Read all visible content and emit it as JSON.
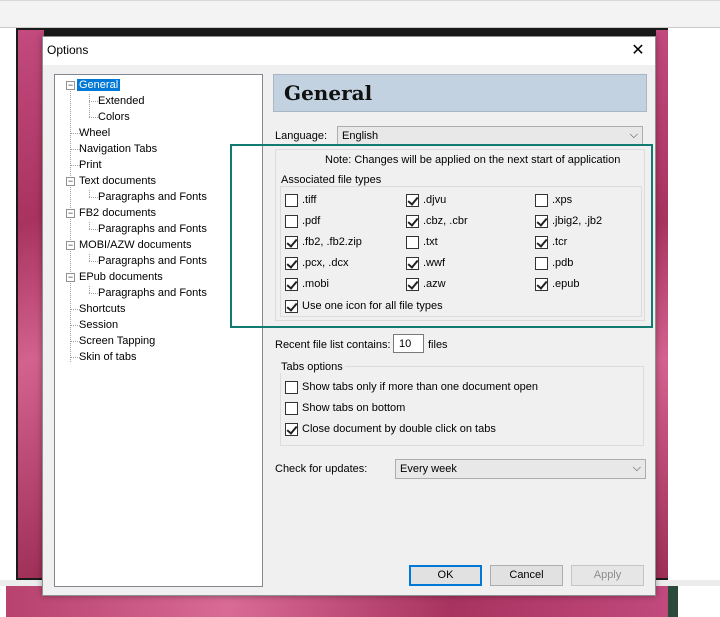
{
  "dialog": {
    "title": "Options"
  },
  "tree": [
    {
      "label": "General",
      "selected": true
    },
    {
      "label": "Extended"
    },
    {
      "label": "Colors"
    },
    {
      "label": "Wheel"
    },
    {
      "label": "Navigation Tabs"
    },
    {
      "label": "Print"
    },
    {
      "label": "Text documents"
    },
    {
      "label": "Paragraphs and Fonts"
    },
    {
      "label": "FB2 documents"
    },
    {
      "label": "Paragraphs and Fonts"
    },
    {
      "label": "MOBI/AZW documents"
    },
    {
      "label": "Paragraphs and Fonts"
    },
    {
      "label": "EPub documents"
    },
    {
      "label": "Paragraphs and Fonts"
    },
    {
      "label": "Shortcuts"
    },
    {
      "label": "Session"
    },
    {
      "label": "Screen Tapping"
    },
    {
      "label": "Skin of tabs"
    }
  ],
  "tree_expanders": [
    "−",
    "−",
    "−",
    "−",
    "−"
  ],
  "page": {
    "header": "General",
    "language_label": "Language:",
    "language_value": "English",
    "note": "Note: Changes will be applied on the next start of application",
    "assoc_title": "Associated file types",
    "filetypes": [
      {
        "label": ".tiff",
        "checked": false
      },
      {
        "label": ".djvu",
        "checked": true
      },
      {
        "label": ".xps",
        "checked": false
      },
      {
        "label": ".pdf",
        "checked": false
      },
      {
        "label": ".cbz, .cbr",
        "checked": true
      },
      {
        "label": ".jbig2, .jb2",
        "checked": true
      },
      {
        "label": ".fb2, .fb2.zip",
        "checked": true
      },
      {
        "label": ".txt",
        "checked": false
      },
      {
        "label": ".tcr",
        "checked": true
      },
      {
        "label": ".pcx, .dcx",
        "checked": true
      },
      {
        "label": ".wwf",
        "checked": true
      },
      {
        "label": ".pdb",
        "checked": false
      },
      {
        "label": ".mobi",
        "checked": true
      },
      {
        "label": ".azw",
        "checked": true
      },
      {
        "label": ".epub",
        "checked": true
      }
    ],
    "one_icon": {
      "label": "Use one icon for all file types",
      "checked": true
    },
    "recent_label": "Recent file list contains:",
    "recent_value": "10",
    "recent_suffix": "files",
    "tabs_title": "Tabs options",
    "tabs_options": [
      {
        "label": "Show tabs only if more than one document open",
        "checked": false
      },
      {
        "label": "Show tabs on bottom",
        "checked": false
      },
      {
        "label": "Close document by double click on tabs",
        "checked": true
      }
    ],
    "updates_label": "Check for updates:",
    "updates_value": "Every week"
  },
  "buttons": {
    "ok": "OK",
    "cancel": "Cancel",
    "apply": "Apply"
  },
  "icons": {
    "close": "✕",
    "dropdown": "⌵"
  },
  "colors": {
    "selection": "#0078d7",
    "header_bg": "#c3d2e0",
    "highlight_border": "#117b72"
  }
}
